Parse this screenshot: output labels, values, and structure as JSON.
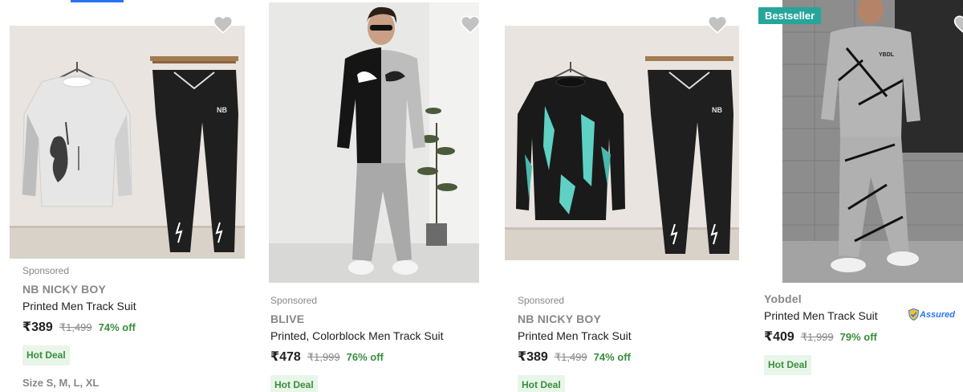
{
  "products": [
    {
      "sponsored": "Sponsored",
      "brand": "NB NICKY BOY",
      "title": "Printed Men Track Suit",
      "price": "₹389",
      "mrp": "₹1,499",
      "discount": "74% off",
      "deal": "Hot Deal",
      "size_label": "Size",
      "sizes": "S, M, L, XL"
    },
    {
      "sponsored": "Sponsored",
      "brand": "BLIVE",
      "title": "Printed, Colorblock Men Track Suit",
      "price": "₹478",
      "mrp": "₹1,999",
      "discount": "76% off",
      "deal": "Hot Deal"
    },
    {
      "sponsored": "Sponsored",
      "brand": "NB NICKY BOY",
      "title": "Printed Men Track Suit",
      "price": "₹389",
      "mrp": "₹1,499",
      "discount": "74% off",
      "deal": "Hot Deal"
    },
    {
      "badge": "Bestseller",
      "brand": "Yobdel",
      "title": "Printed Men Track Suit",
      "price": "₹409",
      "mrp": "₹1,999",
      "discount": "79% off",
      "deal": "Hot Deal",
      "assured": "Assured"
    }
  ],
  "image_text": {
    "nb_logo": "NB",
    "yobdel_logo": "YBDL"
  },
  "colors": {
    "discount_green": "#388e3c",
    "deal_bg": "#e8f5e9",
    "badge_teal": "#26a69a",
    "accent_blue": "#2874f0",
    "heart_grey": "#c2c2c2"
  },
  "icons": [
    "wishlist-heart-icon",
    "assured-shield-icon"
  ]
}
